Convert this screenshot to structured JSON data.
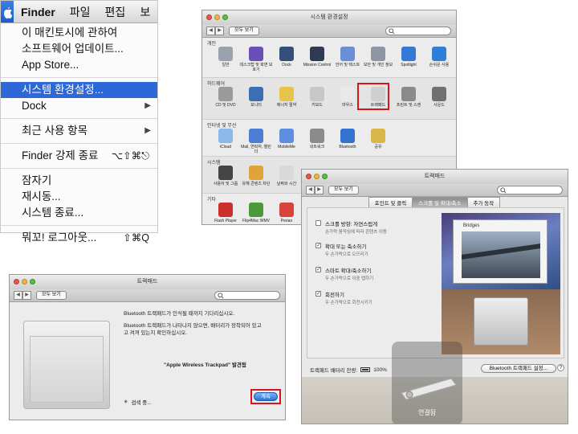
{
  "apple_menu": {
    "menubar": {
      "finder": "Finder",
      "file": "파일",
      "edit": "편집",
      "view": "보"
    },
    "items": {
      "about": "이 매킨토시에 관하여",
      "software_update": "소프트웨어 업데이트...",
      "app_store": "App Store...",
      "system_prefs": "시스템 환경설정...",
      "dock": "Dock",
      "recent": "최근 사용 항목",
      "force_quit": "Finder 강제 종료",
      "force_quit_shortcut": "⌥⇧⌘⎋",
      "sleep": "잠자기",
      "restart": "재시동...",
      "shutdown": "시스템 종료...",
      "logout": "뭐꼬! 로그아웃...",
      "logout_shortcut": "⇧⌘Q"
    },
    "selected_item": "system_prefs"
  },
  "system_prefs": {
    "title": "시스템 환경설정",
    "show_all": "모두 보기",
    "sections": {
      "personal": "개인",
      "hardware": "하드웨어",
      "internet": "인터넷 및 무선",
      "system": "시스템",
      "other": "기타"
    },
    "personal_items": [
      {
        "label": "일반",
        "color": "#9aa3ad"
      },
      {
        "label": "데스크탑 및 화면 보호기",
        "color": "#6a4fb6"
      },
      {
        "label": "Dock",
        "color": "#34507a"
      },
      {
        "label": "Mission Control",
        "color": "#2f3b52"
      },
      {
        "label": "언어 및 텍스트",
        "color": "#6b8fd6"
      },
      {
        "label": "보안 및 개인 정보",
        "color": "#8f96a3"
      },
      {
        "label": "Spotlight",
        "color": "#3579d6"
      },
      {
        "label": "손쉬운 사용",
        "color": "#2f7fd8"
      }
    ],
    "hardware_items": [
      {
        "label": "CD 및 DVD",
        "color": "#9b9b9b"
      },
      {
        "label": "모니터",
        "color": "#3b6fb3"
      },
      {
        "label": "에너지 절약",
        "color": "#e5c44a"
      },
      {
        "label": "키보드",
        "color": "#c7c7c7"
      },
      {
        "label": "마우스",
        "color": "#e9e9e9"
      },
      {
        "label": "트랙패드",
        "color": "#cfcfcf"
      },
      {
        "label": "프린트 및 스캔",
        "color": "#8a8a8a"
      },
      {
        "label": "사운드",
        "color": "#707070"
      }
    ],
    "internet_items": [
      {
        "label": "iCloud",
        "color": "#8bb9ea"
      },
      {
        "label": "Mail, 연락처, 캘린더",
        "color": "#4c7fd4"
      },
      {
        "label": "MobileMe",
        "color": "#5d8ee0"
      },
      {
        "label": "네트워크",
        "color": "#8b8b8b"
      },
      {
        "label": "Bluetooth",
        "color": "#3474d1"
      },
      {
        "label": "공유",
        "color": "#d9b64a"
      }
    ],
    "system_items": [
      {
        "label": "사용자 및 그룹",
        "color": "#444444"
      },
      {
        "label": "유해 콘텐츠 차단",
        "color": "#e0a33a"
      },
      {
        "label": "날짜와 시간",
        "color": "#d9d9d9"
      }
    ],
    "other_items": [
      {
        "label": "Flash Player",
        "color": "#c9302c"
      },
      {
        "label": "Flip4Mac WMV",
        "color": "#4a9a3a"
      },
      {
        "label": "Perian",
        "color": "#d8443a"
      }
    ]
  },
  "trackpad_main": {
    "title": "트랙패드",
    "show_all": "모두 보기",
    "tabs": {
      "tab1": "포인트 및 클릭",
      "tab2": "스크롤 및 확대/축소",
      "tab3": "추가 동작"
    },
    "options": [
      {
        "title": "스크롤 방향: 자연스럽게",
        "desc": "손가락 움직임에 따라 콘텐츠 이동",
        "checked": false
      },
      {
        "title": "확대 또는 축소하기",
        "desc": "두 손가락으로 오므리기",
        "checked": true
      },
      {
        "title": "스마트 확대/축소하기",
        "desc": "두 손가락으로 이중 탭하기",
        "checked": true
      },
      {
        "title": "회전하기",
        "desc": "두 손가락으로 회전시키기",
        "checked": true
      }
    ],
    "preview_caption": "Bridges",
    "battery_label": "트랙패드 배터리 잔량:",
    "battery_value": "100%",
    "bt_button": "Bluetooth 트랙패드 설정...",
    "help": "?",
    "hud_text": "연결됨"
  },
  "trackpad_small": {
    "title": "트랙패드",
    "show_all": "모두 보기",
    "line1": "Bluetooth 트랙패드가 인식될 때까지 기다리십시오.",
    "line2": "Bluetooth 트랙패드가 나타나지 않으면, 배터리가 장착되어 있고",
    "line3": "고 켜져 있는지 확인하십시오.",
    "found": "\"Apple Wireless Trackpad\" 발견됨",
    "searching": "검색 중...",
    "continue": "계속"
  }
}
